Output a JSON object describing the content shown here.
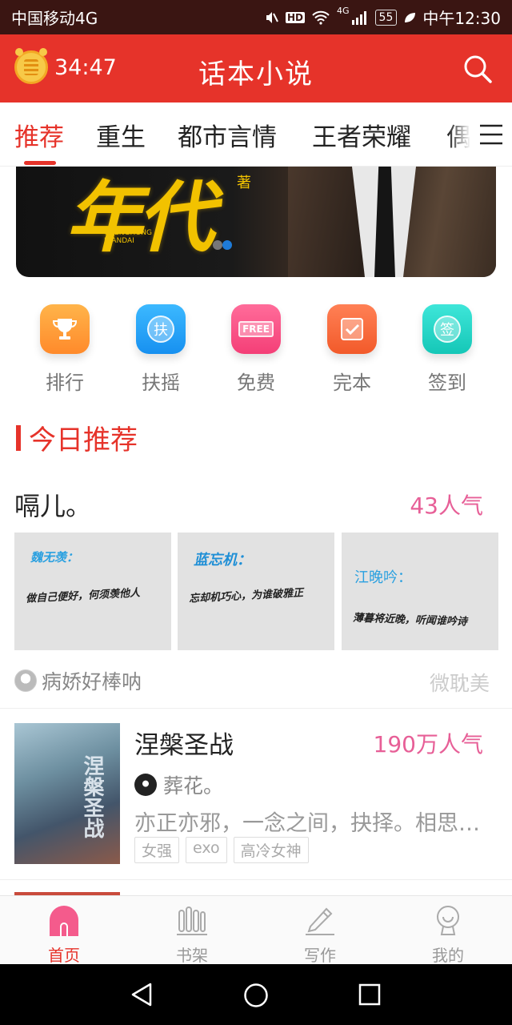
{
  "status_bar": {
    "carrier": "中国移动4G",
    "hd": "HD",
    "network": "4G",
    "battery": "55",
    "time": "中午12:30"
  },
  "header": {
    "timer": "34:47",
    "title": "话本小说",
    "accent": "#e6332a"
  },
  "tabs": [
    {
      "label": "推荐",
      "active": true
    },
    {
      "label": "重生"
    },
    {
      "label": "都市言情"
    },
    {
      "label": "王者荣耀"
    },
    {
      "label": "偶"
    }
  ],
  "banner": {
    "text": "年代",
    "zhu": "著",
    "sub": "CHENGHONG NIANDAI"
  },
  "quick_links": [
    {
      "label": "排行",
      "icon": "trophy-icon"
    },
    {
      "label": "扶摇",
      "icon": "fuyao-icon",
      "glyph": "扶"
    },
    {
      "label": "免费",
      "icon": "free-icon",
      "glyph": "FREE"
    },
    {
      "label": "完本",
      "icon": "check-icon"
    },
    {
      "label": "签到",
      "icon": "signin-icon",
      "glyph": "签"
    }
  ],
  "section": {
    "title": "今日推荐"
  },
  "featured": {
    "title": "嗝儿。",
    "popularity": "43人气",
    "thumbs": [
      {
        "title": "魏无羡：",
        "line": "做自己便好，何须羡他人"
      },
      {
        "title": "蓝忘机：",
        "line": "忘却机巧心，为谁破雅正"
      },
      {
        "title": "江晚吟：",
        "line": "薄暮将近晚，听闻谁吟诗"
      }
    ],
    "author": "病娇好棒呐",
    "category": "微耽美"
  },
  "book": {
    "title": "涅槃圣战",
    "cover_text": "涅槃圣战",
    "popularity": "190万人气",
    "author": "葬花。",
    "description": "亦正亦邪，一念之间，抉择。相思…",
    "tags": [
      "女强",
      "exo",
      "高冷女神"
    ]
  },
  "bottom_nav": [
    {
      "label": "首页",
      "icon": "home-icon",
      "active": true
    },
    {
      "label": "书架",
      "icon": "bookshelf-icon"
    },
    {
      "label": "写作",
      "icon": "pen-icon"
    },
    {
      "label": "我的",
      "icon": "profile-icon"
    }
  ]
}
